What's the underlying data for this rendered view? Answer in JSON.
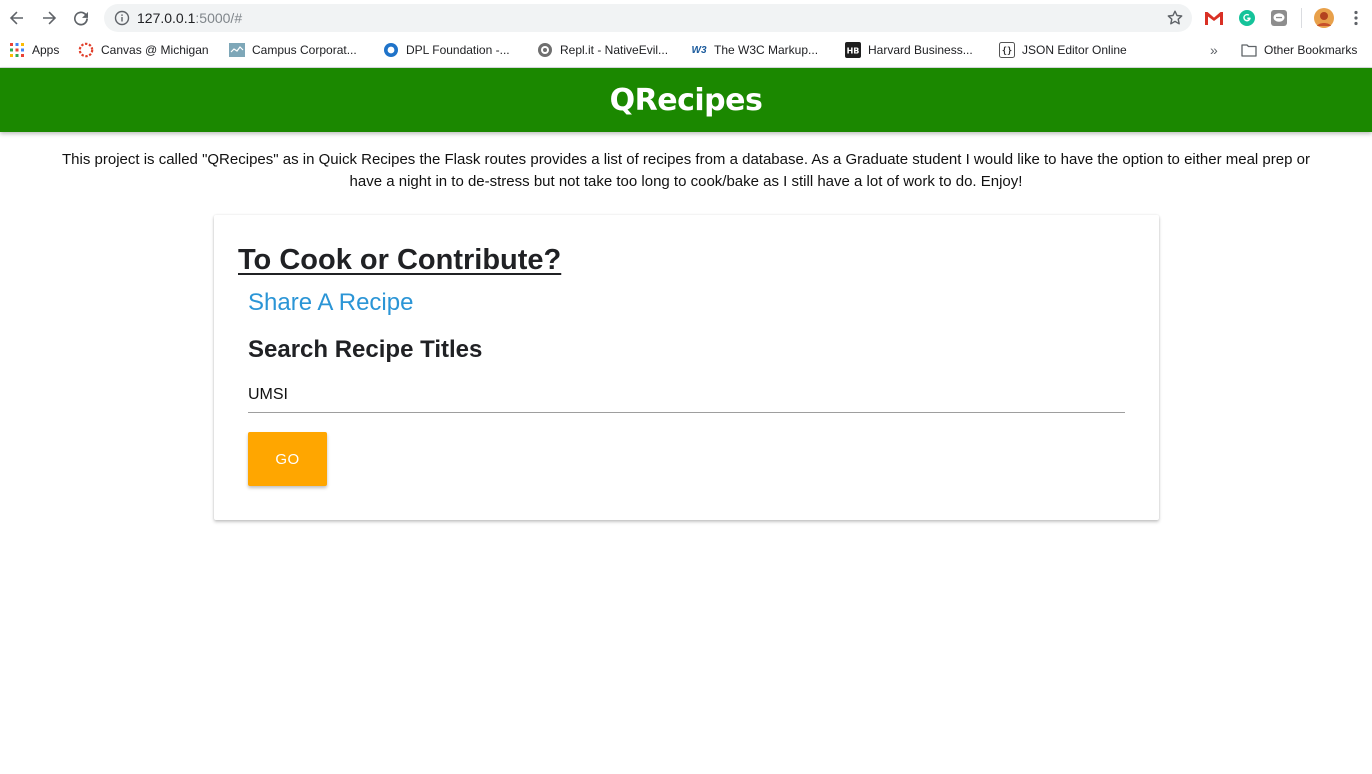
{
  "browser": {
    "url_host": "127.0.0.1",
    "url_rest": ":5000/#",
    "bookmarks": [
      {
        "label": "Apps",
        "icon": "apps-grid-icon"
      },
      {
        "label": "Canvas @ Michigan",
        "icon": "canvas-icon"
      },
      {
        "label": "Campus Corporat...",
        "icon": "campus-icon"
      },
      {
        "label": "DPL Foundation -...",
        "icon": "dpl-icon"
      },
      {
        "label": "Repl.it - NativeEvil...",
        "icon": "replit-icon"
      },
      {
        "label": "The W3C Markup...",
        "icon": "w3c-icon"
      },
      {
        "label": "Harvard Business...",
        "icon": "hbr-icon"
      },
      {
        "label": "JSON Editor Online",
        "icon": "json-editor-icon"
      }
    ],
    "overflow_label": "»",
    "other_bookmarks": "Other Bookmarks",
    "colors": {
      "chrome_bg": "#ffffff",
      "omnibox_bg": "#f1f3f4"
    }
  },
  "header": {
    "title": "QRecipes",
    "bg_color": "#1b8800"
  },
  "intro": {
    "text": "This project is called \"QRecipes\" as in Quick Recipes the Flask routes provides a list of recipes from a database. As a Graduate student I would like to have the option to either meal prep or have a night in to de-stress but not take too long to cook/bake as I still have a lot of work to do. Enjoy!"
  },
  "card": {
    "title": "To Cook or Contribute?",
    "share_link": "Share A Recipe",
    "search_heading": "Search Recipe Titles",
    "search_value": "UMSI",
    "go_label": "GO",
    "link_color": "#2b95d6",
    "button_color": "#ffa600"
  }
}
